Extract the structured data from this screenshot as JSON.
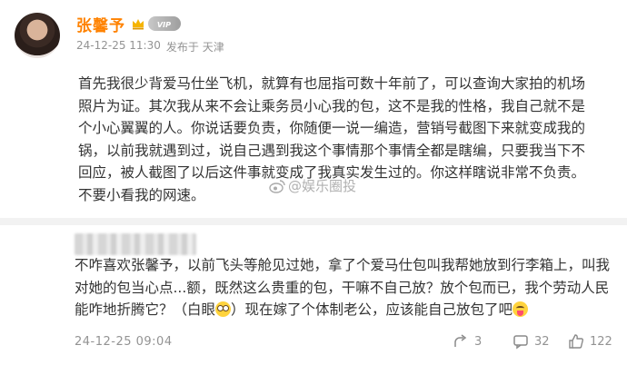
{
  "post": {
    "user_name": "张馨予",
    "time": "24-12-25 11:30",
    "location": "发布于 天津",
    "body_lines": [
      "首先我很少背爱马仕坐飞机，就算有也屈指可数十年前了，可以查询大家拍的机场",
      "照片为证。其次我从来不会让乘务员小心我的包，这不是我的性格，我自己就不是",
      "个小心翼翼的人。你说话要负责，你随便一说一编造，营销号截图下来就变成我的",
      "锅，以前我就遇到过，说自己遇到我这个事情那个事情全都是瞎编，只要我当下不",
      "回应，被人截图了以后这件事就变成了我真实发生过的。你这样瞎说非常不负责。",
      "不要小看我的网速。"
    ],
    "watermark": "@娱乐圈投"
  },
  "comment": {
    "lines": [
      "不咋喜欢张馨予，以前飞头等舱见过她，拿了个爱马仕包叫我帮她放到行李箱上，叫我",
      "对她的包当心点...额，既然这么贵重的包，干嘛不自己放？放个包而已，我个劳动人民",
      "能咋地折腾它？（白眼"
    ],
    "line3_mid": "）现在嫁了个体制老公，应该能自己放包了吧",
    "time": "24-12-25 09:04",
    "share_count": "3",
    "comment_count": "32",
    "like_count": "122"
  },
  "icons": {
    "crown": "crown-icon",
    "vip": "vip-badge",
    "eye_roll": "eye-roll-emoji",
    "tongue": "tongue-emoji",
    "share": "share-icon",
    "comment": "comment-icon",
    "like": "like-icon"
  },
  "colors": {
    "user_name": "#ff8200",
    "meta": "#939393",
    "text": "#333333",
    "divider": "#f2f2f2"
  }
}
